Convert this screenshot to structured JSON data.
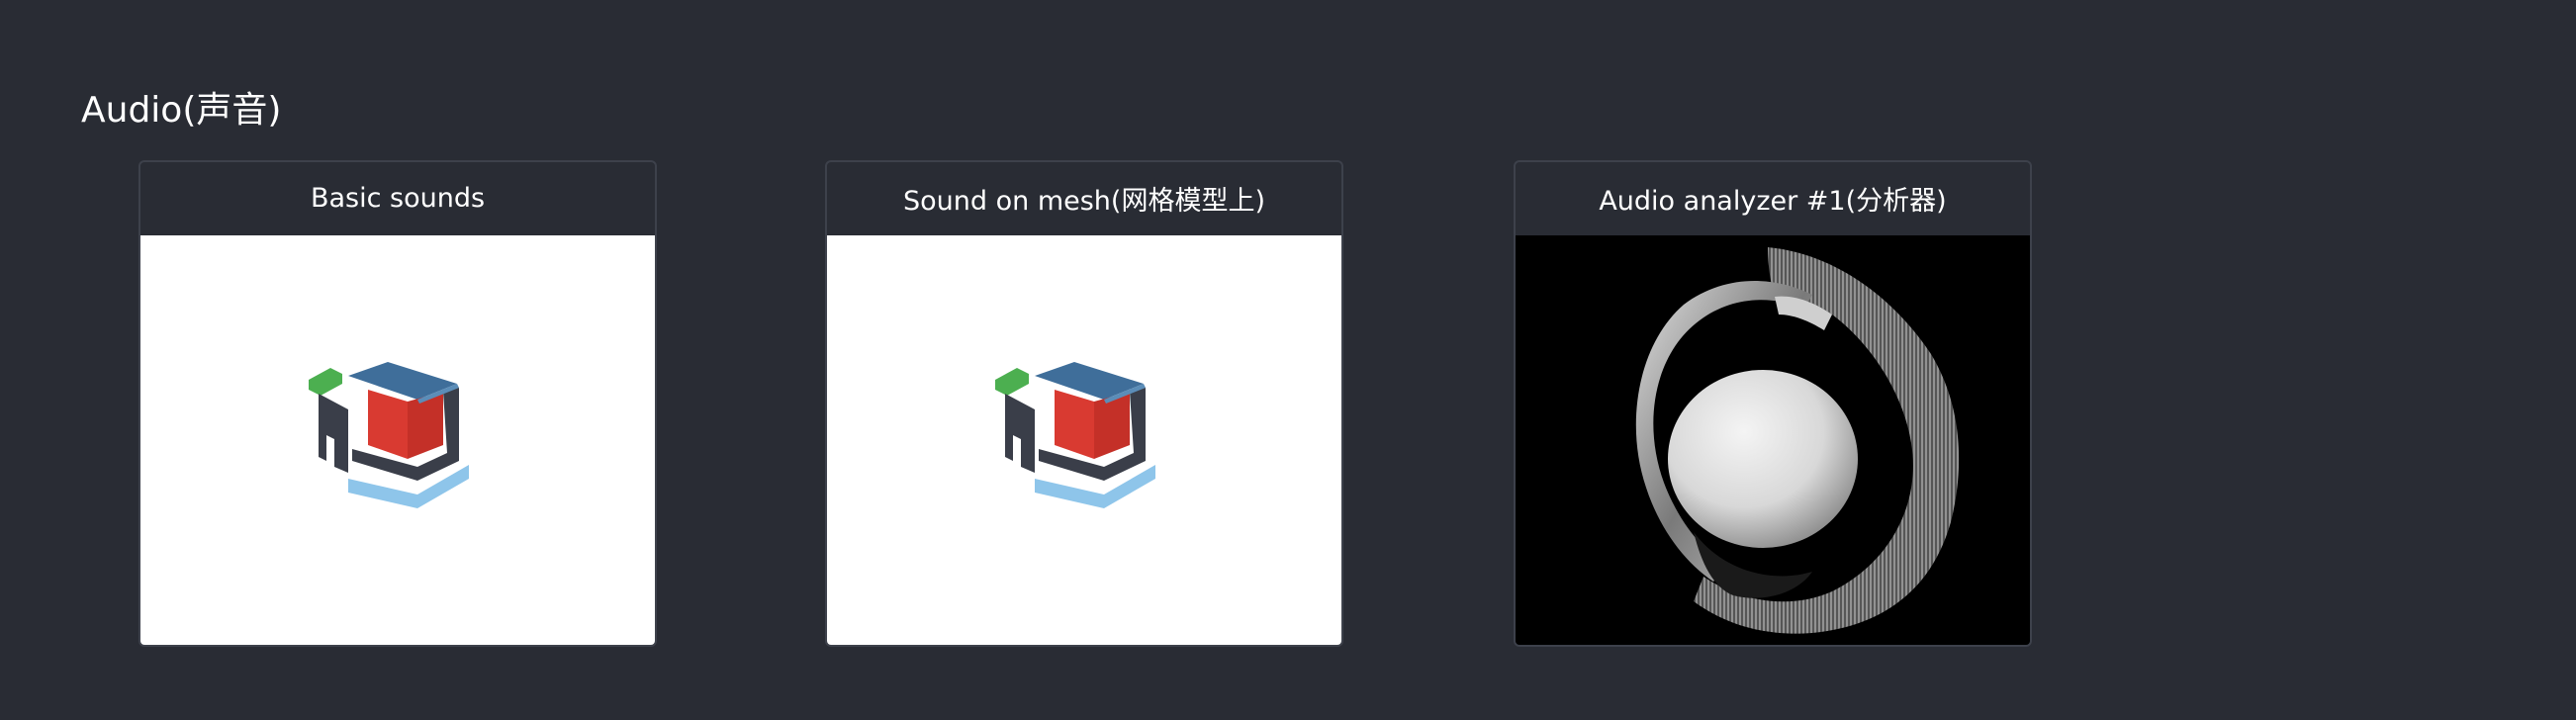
{
  "section": {
    "title": "Audio(声音)"
  },
  "cards": [
    {
      "title": "Basic sounds",
      "thumbnail": "babylonjs-logo-cube"
    },
    {
      "title": "Sound on mesh(网格模型上)",
      "thumbnail": "babylonjs-logo-cube"
    },
    {
      "title": "Audio analyzer #1(分析器)",
      "thumbnail": "audio-analyzer-sphere-ring"
    }
  ],
  "colors": {
    "background": "#292c34",
    "card_border": "#3d414b",
    "logo_red": "#d93a31",
    "logo_blue": "#3f6e9a",
    "logo_dark": "#3a3e49",
    "logo_green": "#4caf50",
    "logo_light_blue": "#8ec5ea"
  }
}
